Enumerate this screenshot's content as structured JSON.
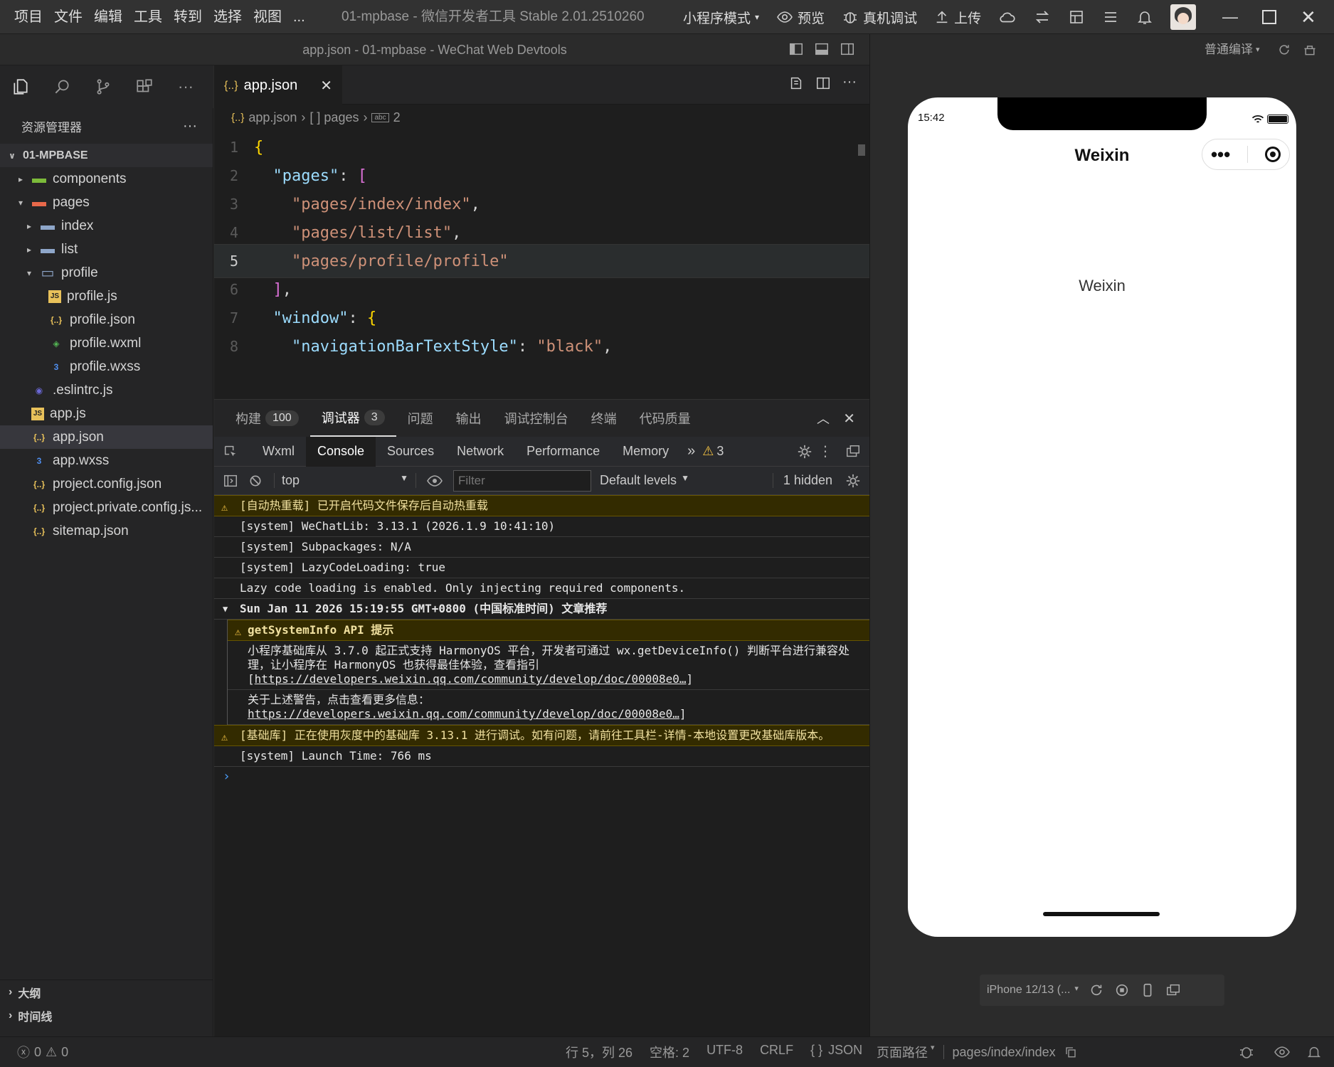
{
  "menu": [
    "项目",
    "文件",
    "编辑",
    "工具",
    "转到",
    "选择",
    "视图",
    "..."
  ],
  "app_title": "01-mpbase - 微信开发者工具 Stable 2.01.2510260",
  "toolbar": {
    "mode": "小程序模式",
    "preview": "预览",
    "device_debug": "真机调试",
    "upload": "上传"
  },
  "window_subtitle": "app.json - 01-mpbase - WeChat Web Devtools",
  "sim_compile": "普通编译",
  "explorer": {
    "title": "资源管理器",
    "more": "···",
    "project": "01-MPBASE",
    "items": [
      {
        "label": "components",
        "depth": 1,
        "caret": "▸",
        "type": "folder-green"
      },
      {
        "label": "pages",
        "depth": 1,
        "caret": "▾",
        "type": "folder-red"
      },
      {
        "label": "index",
        "depth": 2,
        "caret": "▸",
        "type": "folder"
      },
      {
        "label": "list",
        "depth": 2,
        "caret": "▸",
        "type": "folder"
      },
      {
        "label": "profile",
        "depth": 2,
        "caret": "▾",
        "type": "folder-open"
      },
      {
        "label": "profile.js",
        "depth": 3,
        "caret": "",
        "type": "js"
      },
      {
        "label": "profile.json",
        "depth": 3,
        "caret": "",
        "type": "json"
      },
      {
        "label": "profile.wxml",
        "depth": 3,
        "caret": "",
        "type": "wxml"
      },
      {
        "label": "profile.wxss",
        "depth": 3,
        "caret": "",
        "type": "wxss"
      },
      {
        "label": ".eslintrc.js",
        "depth": 1,
        "caret": "",
        "type": "eslint"
      },
      {
        "label": "app.js",
        "depth": 1,
        "caret": "",
        "type": "js"
      },
      {
        "label": "app.json",
        "depth": 1,
        "caret": "",
        "type": "json",
        "selected": true
      },
      {
        "label": "app.wxss",
        "depth": 1,
        "caret": "",
        "type": "wxss"
      },
      {
        "label": "project.config.json",
        "depth": 1,
        "caret": "",
        "type": "json"
      },
      {
        "label": "project.private.config.js...",
        "depth": 1,
        "caret": "",
        "type": "json"
      },
      {
        "label": "sitemap.json",
        "depth": 1,
        "caret": "",
        "type": "json"
      }
    ],
    "outline": "大纲",
    "timeline": "时间线"
  },
  "editor": {
    "tab_label": "app.json",
    "tab_icon": "{..}",
    "breadcrumb": [
      "app.json",
      "[ ] pages",
      "2"
    ],
    "lines": [
      {
        "n": "1",
        "code": "{"
      },
      {
        "n": "2",
        "code": "  \"pages\": ["
      },
      {
        "n": "3",
        "code": "    \"pages/index/index\","
      },
      {
        "n": "4",
        "code": "    \"pages/list/list\","
      },
      {
        "n": "5",
        "code": "    \"pages/profile/profile\""
      },
      {
        "n": "6",
        "code": "  ],"
      },
      {
        "n": "7",
        "code": "  \"window\": {"
      },
      {
        "n": "8",
        "code": "    \"navigationBarTextStyle\": \"black\","
      }
    ]
  },
  "panel": {
    "tabs": [
      {
        "label": "构建",
        "badge": "100"
      },
      {
        "label": "调试器",
        "badge": "3"
      },
      {
        "label": "问题",
        "badge": ""
      },
      {
        "label": "输出",
        "badge": ""
      },
      {
        "label": "调试控制台",
        "badge": ""
      },
      {
        "label": "终端",
        "badge": ""
      },
      {
        "label": "代码质量",
        "badge": ""
      }
    ]
  },
  "devtools": {
    "tabs": [
      "Wxml",
      "Console",
      "Sources",
      "Network",
      "Performance",
      "Memory"
    ],
    "warn_count": "3",
    "context": "top",
    "filter_placeholder": "Filter",
    "levels": "Default levels",
    "hidden": "1 hidden"
  },
  "console": {
    "l1": "[自动热重载] 已开启代码文件保存后自动热重载",
    "l2": "[system] WeChatLib: 3.13.1 (2026.1.9 10:41:10)",
    "l3": "[system] Subpackages: N/A",
    "l4": "[system] LazyCodeLoading: true",
    "l5": "Lazy code loading is enabled. Only injecting required components.",
    "group": "Sun Jan 11 2026 15:19:55 GMT+0800 (中国标准时间) 文章推荐",
    "g_title": "getSystemInfo API 提示",
    "g_text1": "小程序基础库从 3.7.0 起正式支持 HarmonyOS 平台，开发者可通过 wx.getDeviceInfo() 判断平台进行兼容处理，让小程序在 HarmonyOS 也获得最佳体验，查看指引[",
    "g_link1": "https://developers.weixin.qq.com/community/develop/doc/00008e0…",
    "g_text2": "关于上述警告，点击查看更多信息：",
    "g_link2": "https://developers.weixin.qq.com/community/develop/doc/00008e0…",
    "l6": "[基础库] 正在使用灰度中的基础库 3.13.1 进行调试。如有问题，请前往工具栏-详情-本地设置更改基础库版本。",
    "l7": "[system] Launch Time: 766 ms",
    "prompt": "›"
  },
  "status": {
    "errors": "0",
    "warnings": "0",
    "position": "行 5，列 26",
    "spaces": "空格: 2",
    "encoding": "UTF-8",
    "eol": "CRLF",
    "lang": "JSON",
    "page_path_label": "页面路径",
    "page_path": "pages/index/index"
  },
  "phone": {
    "time": "15:42",
    "nav_title": "Weixin",
    "content": "Weixin",
    "device": "iPhone 12/13 (..."
  }
}
